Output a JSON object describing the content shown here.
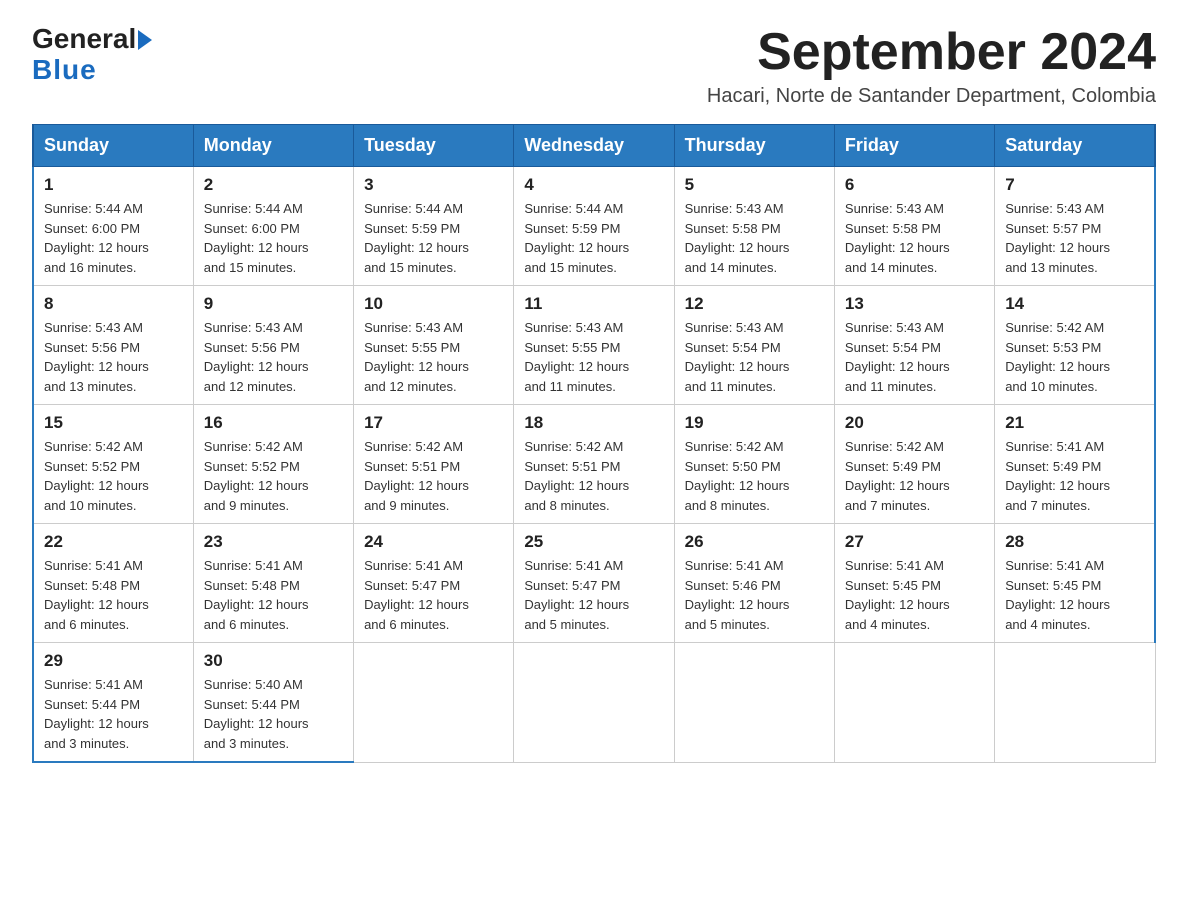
{
  "logo": {
    "general": "General",
    "blue": "Blue"
  },
  "title": "September 2024",
  "subtitle": "Hacari, Norte de Santander Department, Colombia",
  "days": [
    "Sunday",
    "Monday",
    "Tuesday",
    "Wednesday",
    "Thursday",
    "Friday",
    "Saturday"
  ],
  "weeks": [
    [
      {
        "day": "1",
        "sunrise": "5:44 AM",
        "sunset": "6:00 PM",
        "daylight": "12 hours and 16 minutes."
      },
      {
        "day": "2",
        "sunrise": "5:44 AM",
        "sunset": "6:00 PM",
        "daylight": "12 hours and 15 minutes."
      },
      {
        "day": "3",
        "sunrise": "5:44 AM",
        "sunset": "5:59 PM",
        "daylight": "12 hours and 15 minutes."
      },
      {
        "day": "4",
        "sunrise": "5:44 AM",
        "sunset": "5:59 PM",
        "daylight": "12 hours and 15 minutes."
      },
      {
        "day": "5",
        "sunrise": "5:43 AM",
        "sunset": "5:58 PM",
        "daylight": "12 hours and 14 minutes."
      },
      {
        "day": "6",
        "sunrise": "5:43 AM",
        "sunset": "5:58 PM",
        "daylight": "12 hours and 14 minutes."
      },
      {
        "day": "7",
        "sunrise": "5:43 AM",
        "sunset": "5:57 PM",
        "daylight": "12 hours and 13 minutes."
      }
    ],
    [
      {
        "day": "8",
        "sunrise": "5:43 AM",
        "sunset": "5:56 PM",
        "daylight": "12 hours and 13 minutes."
      },
      {
        "day": "9",
        "sunrise": "5:43 AM",
        "sunset": "5:56 PM",
        "daylight": "12 hours and 12 minutes."
      },
      {
        "day": "10",
        "sunrise": "5:43 AM",
        "sunset": "5:55 PM",
        "daylight": "12 hours and 12 minutes."
      },
      {
        "day": "11",
        "sunrise": "5:43 AM",
        "sunset": "5:55 PM",
        "daylight": "12 hours and 11 minutes."
      },
      {
        "day": "12",
        "sunrise": "5:43 AM",
        "sunset": "5:54 PM",
        "daylight": "12 hours and 11 minutes."
      },
      {
        "day": "13",
        "sunrise": "5:43 AM",
        "sunset": "5:54 PM",
        "daylight": "12 hours and 11 minutes."
      },
      {
        "day": "14",
        "sunrise": "5:42 AM",
        "sunset": "5:53 PM",
        "daylight": "12 hours and 10 minutes."
      }
    ],
    [
      {
        "day": "15",
        "sunrise": "5:42 AM",
        "sunset": "5:52 PM",
        "daylight": "12 hours and 10 minutes."
      },
      {
        "day": "16",
        "sunrise": "5:42 AM",
        "sunset": "5:52 PM",
        "daylight": "12 hours and 9 minutes."
      },
      {
        "day": "17",
        "sunrise": "5:42 AM",
        "sunset": "5:51 PM",
        "daylight": "12 hours and 9 minutes."
      },
      {
        "day": "18",
        "sunrise": "5:42 AM",
        "sunset": "5:51 PM",
        "daylight": "12 hours and 8 minutes."
      },
      {
        "day": "19",
        "sunrise": "5:42 AM",
        "sunset": "5:50 PM",
        "daylight": "12 hours and 8 minutes."
      },
      {
        "day": "20",
        "sunrise": "5:42 AM",
        "sunset": "5:49 PM",
        "daylight": "12 hours and 7 minutes."
      },
      {
        "day": "21",
        "sunrise": "5:41 AM",
        "sunset": "5:49 PM",
        "daylight": "12 hours and 7 minutes."
      }
    ],
    [
      {
        "day": "22",
        "sunrise": "5:41 AM",
        "sunset": "5:48 PM",
        "daylight": "12 hours and 6 minutes."
      },
      {
        "day": "23",
        "sunrise": "5:41 AM",
        "sunset": "5:48 PM",
        "daylight": "12 hours and 6 minutes."
      },
      {
        "day": "24",
        "sunrise": "5:41 AM",
        "sunset": "5:47 PM",
        "daylight": "12 hours and 6 minutes."
      },
      {
        "day": "25",
        "sunrise": "5:41 AM",
        "sunset": "5:47 PM",
        "daylight": "12 hours and 5 minutes."
      },
      {
        "day": "26",
        "sunrise": "5:41 AM",
        "sunset": "5:46 PM",
        "daylight": "12 hours and 5 minutes."
      },
      {
        "day": "27",
        "sunrise": "5:41 AM",
        "sunset": "5:45 PM",
        "daylight": "12 hours and 4 minutes."
      },
      {
        "day": "28",
        "sunrise": "5:41 AM",
        "sunset": "5:45 PM",
        "daylight": "12 hours and 4 minutes."
      }
    ],
    [
      {
        "day": "29",
        "sunrise": "5:41 AM",
        "sunset": "5:44 PM",
        "daylight": "12 hours and 3 minutes."
      },
      {
        "day": "30",
        "sunrise": "5:40 AM",
        "sunset": "5:44 PM",
        "daylight": "12 hours and 3 minutes."
      },
      null,
      null,
      null,
      null,
      null
    ]
  ],
  "labels": {
    "sunrise": "Sunrise:",
    "sunset": "Sunset:",
    "daylight": "Daylight:"
  }
}
